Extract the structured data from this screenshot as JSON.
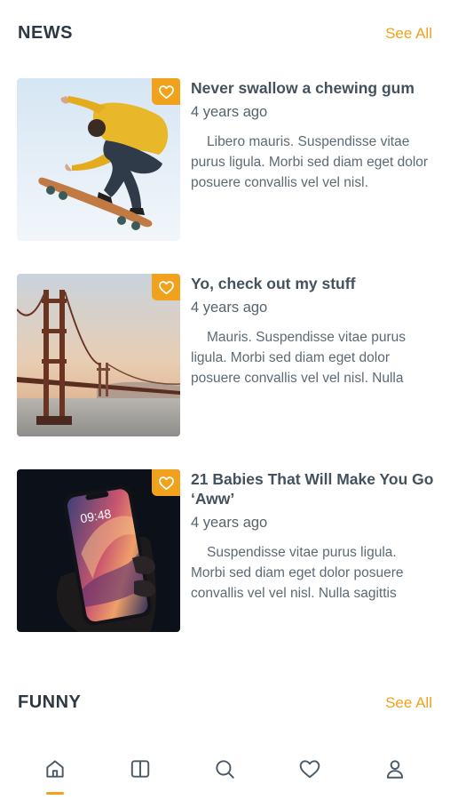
{
  "sections": {
    "news": {
      "title": "NEWS",
      "see_all": "See All"
    },
    "funny": {
      "title": "FUNNY",
      "see_all": "See All"
    }
  },
  "news_items": [
    {
      "title": "Never swallow a chewing gum",
      "time": "4 years ago",
      "excerpt": "Libero mauris. Suspendisse vitae purus ligula. Morbi sed diam eget dolor posuere convallis vel vel nisl.",
      "image": "skateboarder-photo"
    },
    {
      "title": "Yo, check out my stuff",
      "time": "4 years ago",
      "excerpt": "Mauris. Suspendisse vitae purus ligula. Morbi sed diam eget dolor posuere convallis vel vel nisl. Nulla",
      "image": "golden-gate-bridge-photo"
    },
    {
      "title": "21 Babies That Will Make You Go ‘Aww’",
      "time": "4 years ago",
      "excerpt": "Suspendisse vitae purus ligula. Morbi sed diam eget dolor posuere convallis vel vel nisl. Nulla sagittis",
      "image": "smartphone-in-hand-photo",
      "phone_clock": "09:48"
    }
  ],
  "bottom_nav": {
    "items": [
      "home-icon",
      "book-icon",
      "search-icon",
      "heart-icon",
      "user-icon"
    ],
    "active": "home-icon"
  },
  "colors": {
    "accent": "#f0a21c",
    "text_dark": "#2e3842",
    "text_muted": "#5d6a75",
    "icon": "#4b5a66"
  }
}
